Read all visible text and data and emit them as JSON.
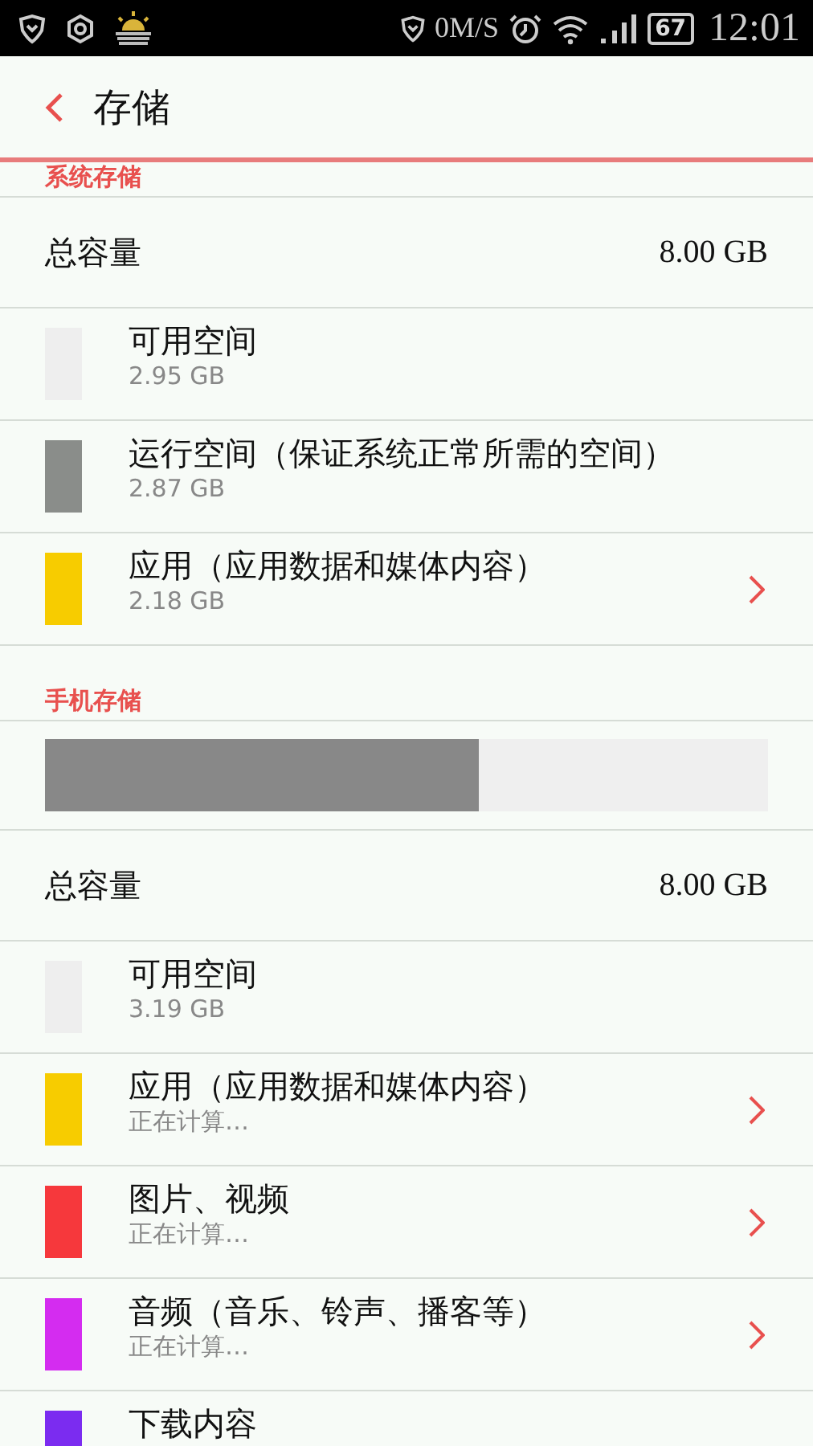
{
  "status_bar": {
    "speed": "0M/S",
    "battery": "67",
    "time": "12:01"
  },
  "header": {
    "title": "存储"
  },
  "sections": [
    {
      "title": "系统存储",
      "total_label": "总容量",
      "total_value": "8.00 GB",
      "items": [
        {
          "name": "可用空间",
          "detail": "2.95 GB",
          "color": "#eeeeee",
          "chevron": false
        },
        {
          "name": "运行空间（保证系统正常所需的空间）",
          "detail": "2.87 GB",
          "color": "#8a8d8a",
          "chevron": false
        },
        {
          "name": "应用（应用数据和媒体内容）",
          "detail": "2.18 GB",
          "color": "#f7cc00",
          "chevron": true
        }
      ]
    },
    {
      "title": "手机存储",
      "bar": {
        "level": 0.6
      },
      "total_label": "总容量",
      "total_value": "8.00 GB",
      "items": [
        {
          "name": "可用空间",
          "detail": "3.19 GB",
          "color": "#eeeeee",
          "chevron": false
        },
        {
          "name": "应用（应用数据和媒体内容）",
          "detail": "正在计算…",
          "color": "#f7cc00",
          "chevron": true
        },
        {
          "name": "图片、视频",
          "detail": "正在计算…",
          "color": "#f6383c",
          "chevron": true
        },
        {
          "name": "音频（音乐、铃声、播客等）",
          "detail": "正在计算…",
          "color": "#d42cf0",
          "chevron": true
        },
        {
          "name": "下载内容",
          "color": "#7b2cf0",
          "chevron": false
        }
      ]
    }
  ]
}
